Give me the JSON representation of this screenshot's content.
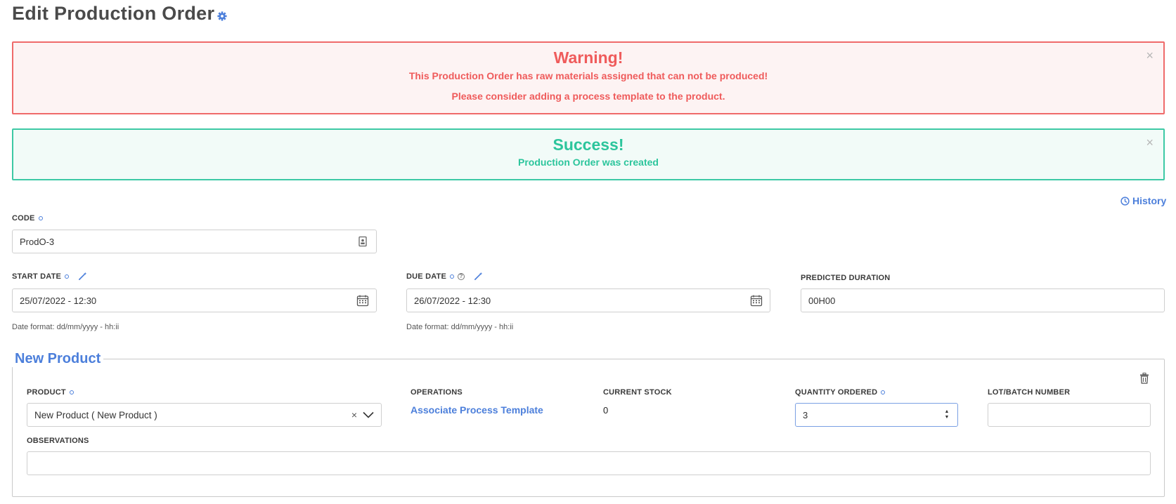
{
  "page": {
    "title": "Edit Production Order",
    "history_label": "History"
  },
  "alerts": {
    "warning": {
      "heading": "Warning!",
      "line1": "This Production Order has raw materials assigned that can not be produced!",
      "line2": "Please consider adding a process template to the product.",
      "close": "×"
    },
    "success": {
      "heading": "Success!",
      "line1": "Production Order was created",
      "close": "×"
    }
  },
  "form": {
    "code": {
      "label": "CODE",
      "value": "ProdO-3"
    },
    "start_date": {
      "label": "START DATE",
      "value": "25/07/2022 - 12:30",
      "hint": "Date format: dd/mm/yyyy - hh:ii"
    },
    "due_date": {
      "label": "DUE DATE",
      "value": "26/07/2022 - 12:30",
      "hint": "Date format: dd/mm/yyyy - hh:ii"
    },
    "predicted_duration": {
      "label": "PREDICTED DURATION",
      "value": "00H00"
    }
  },
  "product_block": {
    "legend": "New Product",
    "product": {
      "label": "PRODUCT",
      "value": "New Product ( New Product )",
      "clear": "×"
    },
    "operations": {
      "label": "OPERATIONS",
      "link": "Associate Process Template"
    },
    "current_stock": {
      "label": "CURRENT STOCK",
      "value": "0"
    },
    "quantity_ordered": {
      "label": "QUANTITY ORDERED",
      "value": "3"
    },
    "lot_batch": {
      "label": "LOT/BATCH NUMBER",
      "value": ""
    },
    "observations": {
      "label": "OBSERVATIONS",
      "value": ""
    }
  },
  "colors": {
    "accent": "#4c7fdb",
    "warning": "#ef5b5b",
    "success": "#2cc59c"
  },
  "icons": [
    "gear-icon",
    "close-icon",
    "clock-icon",
    "wand-icon",
    "help-icon",
    "id-card-icon",
    "calendar-icon",
    "trash-icon",
    "chevron-down-icon"
  ]
}
